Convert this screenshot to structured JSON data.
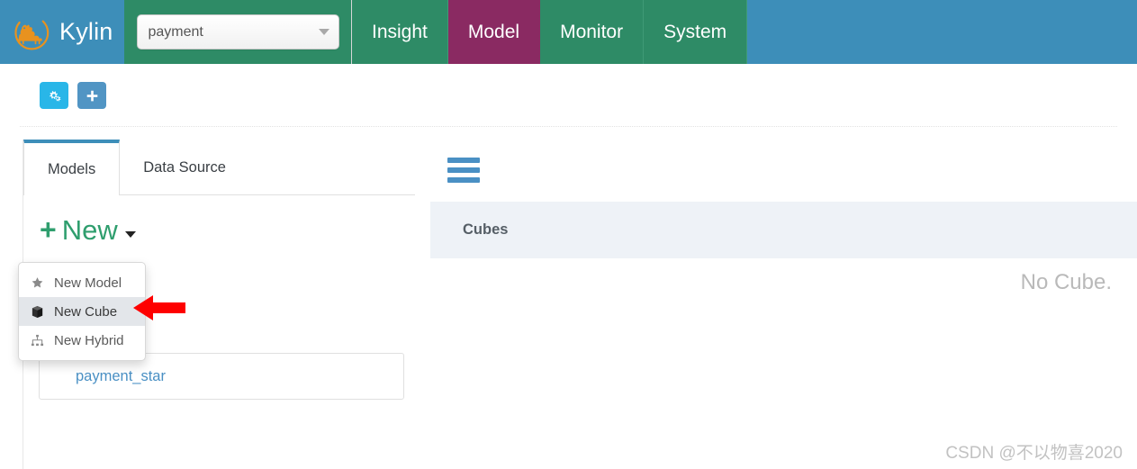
{
  "navbar": {
    "brand": "Kylin",
    "logo_icon": "kylin-logo",
    "project": {
      "value": "payment",
      "caret_icon": "chevron-down-icon"
    },
    "tabs": [
      {
        "label": "Insight",
        "active": false
      },
      {
        "label": "Model",
        "active": true
      },
      {
        "label": "Monitor",
        "active": false
      },
      {
        "label": "System",
        "active": false
      }
    ],
    "colors": {
      "blue": "#3d8eb9",
      "green": "#2e8b66",
      "active_purple": "#8a2a62"
    }
  },
  "toolbar": {
    "buttons": [
      {
        "name": "gears-icon",
        "title": "Manage",
        "color": "#29b6e8"
      },
      {
        "name": "plus-icon",
        "title": "Add",
        "color": "#5195c4"
      }
    ]
  },
  "left_panel": {
    "tabs": [
      {
        "label": "Models",
        "active": true
      },
      {
        "label": "Data Source",
        "active": false
      }
    ],
    "new_button": {
      "plus": "+",
      "label": "New",
      "caret_icon": "caret-down-icon"
    },
    "dropdown": {
      "items": [
        {
          "label": "New Model",
          "icon": "star-icon",
          "highlighted": false
        },
        {
          "label": "New Cube",
          "icon": "cube-icon",
          "highlighted": true
        },
        {
          "label": "New Hybrid",
          "icon": "sitemap-icon",
          "highlighted": false
        }
      ]
    },
    "model_item": {
      "label": "payment_star"
    }
  },
  "right_panel": {
    "menu_icon": "hamburger-icon",
    "section_title": "Cubes",
    "empty_message": "No Cube."
  },
  "annotation": {
    "arrow": {
      "name": "red-arrow-pointer",
      "color": "#ff0000",
      "points_to": "New Cube"
    }
  },
  "watermark": {
    "text": "CSDN @不以物喜2020"
  }
}
